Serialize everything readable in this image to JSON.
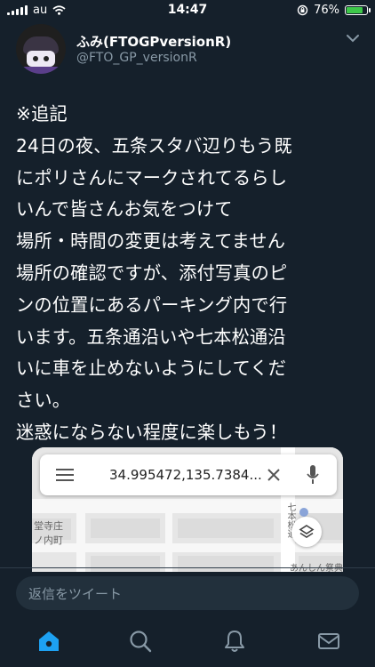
{
  "status_bar": {
    "carrier": "au",
    "time": "14:47",
    "battery_text": "76%",
    "battery_level": 0.76,
    "battery_color": "#3ec84a"
  },
  "tweet": {
    "display_name": "ふみ(FTOGPversionR)",
    "handle": "@FTO_GP_versionR",
    "more_icon": "chevron-down-icon",
    "body_lines": [
      "※追記",
      "24日の夜、五条スタバ辺りもう既",
      "にポリさんにマークされてるらし",
      "いんで皆さんお気をつけて",
      "場所・時間の変更は考えてません",
      "場所の確認ですが、添付写真のピ",
      "ンの位置にあるパーキング内で行",
      "います。五条通沿いや七本松通沿",
      "いに車を止めないようにしてくだ",
      "さい。",
      "迷惑にならない程度に楽しもう！"
    ]
  },
  "map": {
    "search_text": "34.995472,135.7384...",
    "label_left_1": "堂寺庄",
    "label_left_2": "ノ内町",
    "label_street": "七本松通",
    "label_bottom": "あんしん祭典",
    "menu_icon": "hamburger-menu-icon",
    "clear_icon": "close-icon",
    "mic_icon": "microphone-icon",
    "layers_icon": "layers-icon"
  },
  "reply": {
    "placeholder": "返信をツイート"
  },
  "tab_bar": {
    "active_color": "#1da1f2",
    "inactive_color": "#8899a6",
    "tabs": [
      "home-icon",
      "search-icon",
      "bell-icon",
      "mail-icon"
    ]
  }
}
